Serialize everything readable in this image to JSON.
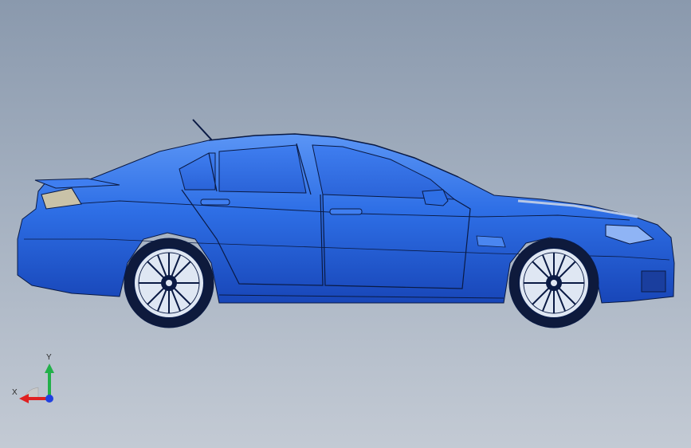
{
  "viewport": {
    "background_top": "#8a99ad",
    "background_bottom": "#c3cad4"
  },
  "model": {
    "body_color": "#2e6fe6",
    "edge_color": "#0a1a44",
    "wheel_color": "#e8eef7",
    "taillight_color": "#c9c2a8"
  },
  "triad": {
    "x_label": "X",
    "y_label": "Y",
    "x_color": "#e02020",
    "y_color": "#22b04a",
    "z_color": "#2040e0"
  }
}
